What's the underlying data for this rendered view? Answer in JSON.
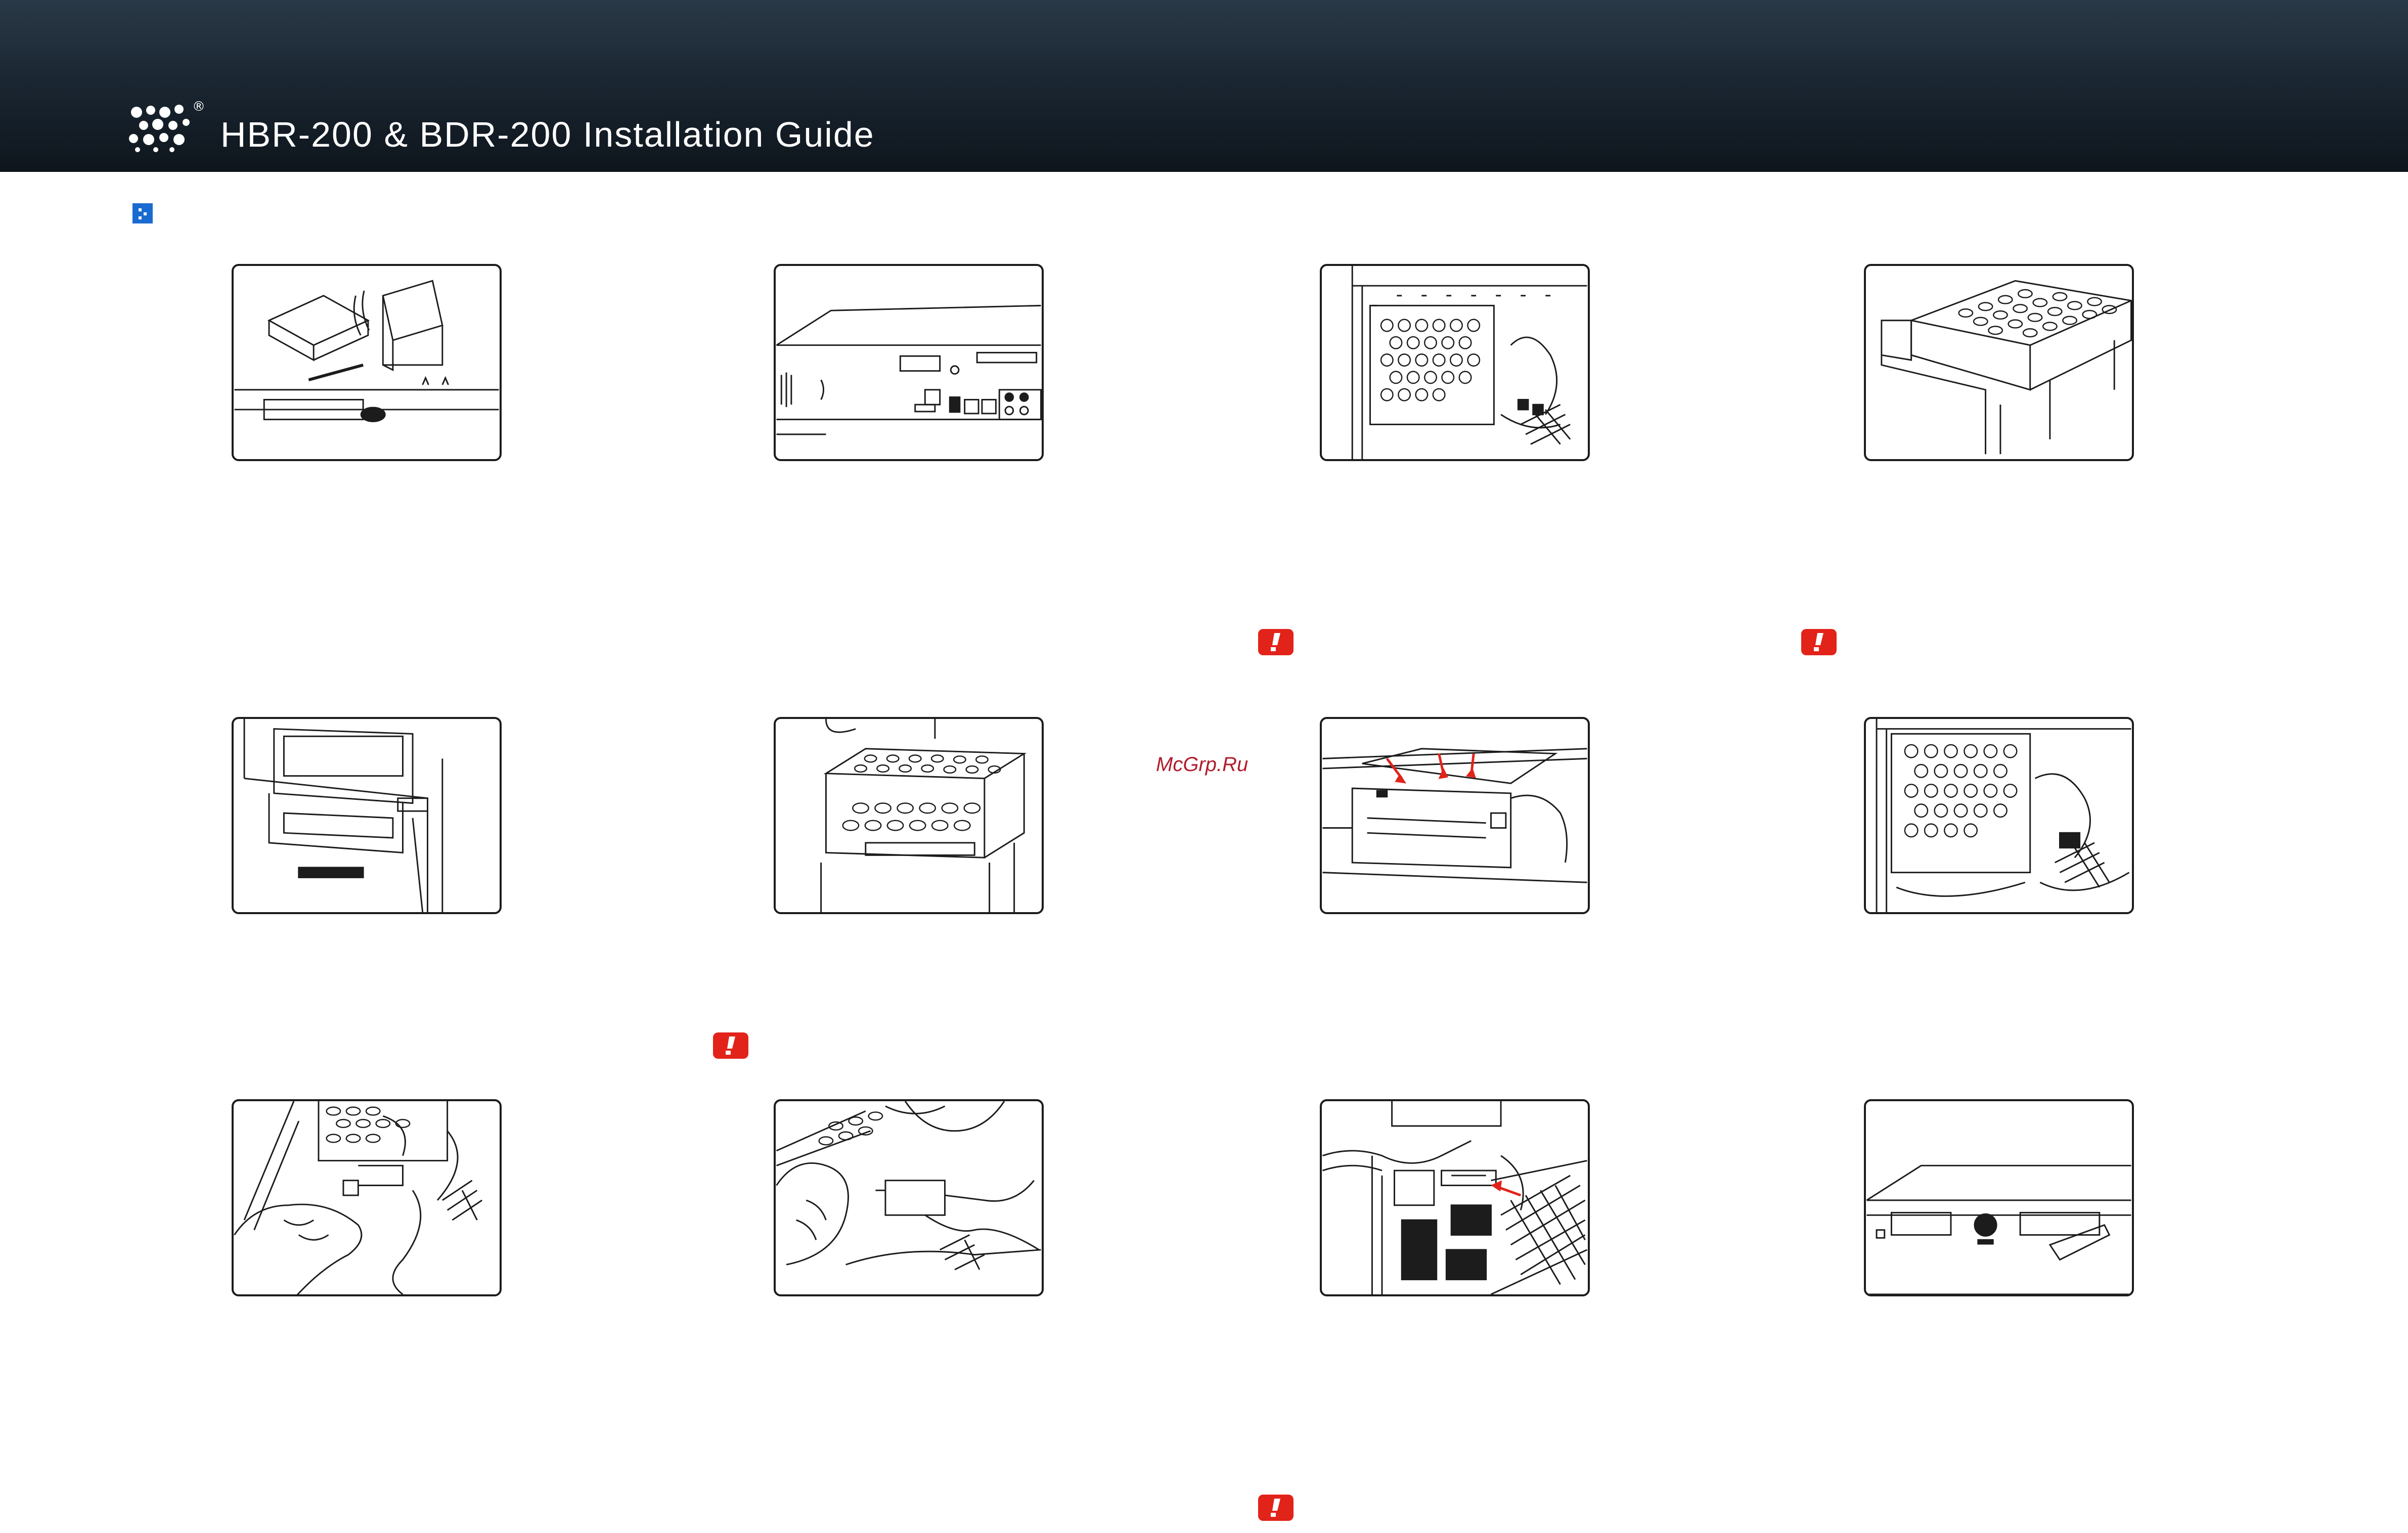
{
  "header": {
    "title": "HBR-200 & BDR-200 Installation Guide",
    "registered_mark": "®"
  },
  "watermark": {
    "text": "McGrp.Ru"
  },
  "colors": {
    "header_dark": "#0e151c",
    "header_light": "#2a3947",
    "marker_blue": "#1a6bd1",
    "warning_red": "#e2231a",
    "watermark_red": "#b11e2c",
    "line": "#1c1c1c"
  },
  "icons": {
    "logo": "bubble-logo-icon",
    "section_marker": "section-marker-icon",
    "warning": "exclamation-warning-icon"
  },
  "panels": [
    "kit-contents-illustration",
    "rear-panel-illustration",
    "open-case-bay-illustration",
    "drive-bracket-illustration",
    "drive-slide-in-illustration",
    "bracket-insert-illustration",
    "mount-screws-illustration",
    "installed-bay-illustration",
    "connect-sata-hand-illustration",
    "connect-power-hand-illustration",
    "motherboard-sata-illustration",
    "front-bezel-illustration"
  ]
}
